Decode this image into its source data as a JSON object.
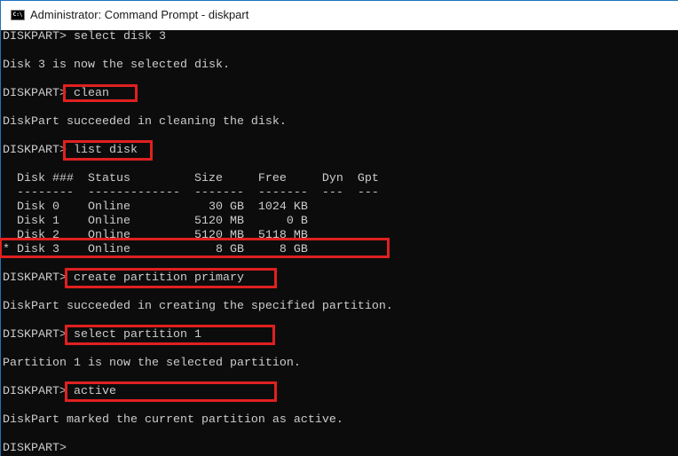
{
  "window": {
    "title": "Administrator: Command Prompt - diskpart",
    "icon": "cmd-icon"
  },
  "console_lines": [
    "DISKPART> select disk 3",
    "",
    "Disk 3 is now the selected disk.",
    "",
    "DISKPART> clean",
    "",
    "DiskPart succeeded in cleaning the disk.",
    "",
    "DISKPART> list disk",
    "",
    "  Disk ###  Status         Size     Free     Dyn  Gpt",
    "  --------  -------------  -------  -------  ---  ---",
    "  Disk 0    Online           30 GB  1024 KB",
    "  Disk 1    Online         5120 MB      0 B",
    "  Disk 2    Online         5120 MB  5118 MB",
    "* Disk 3    Online            8 GB     8 GB",
    "",
    "DISKPART> create partition primary",
    "",
    "DiskPart succeeded in creating the specified partition.",
    "",
    "DISKPART> select partition 1",
    "",
    "Partition 1 is now the selected partition.",
    "",
    "DISKPART> active",
    "",
    "DiskPart marked the current partition as active.",
    "",
    "DISKPART> "
  ],
  "highlight_color": "#e02020"
}
